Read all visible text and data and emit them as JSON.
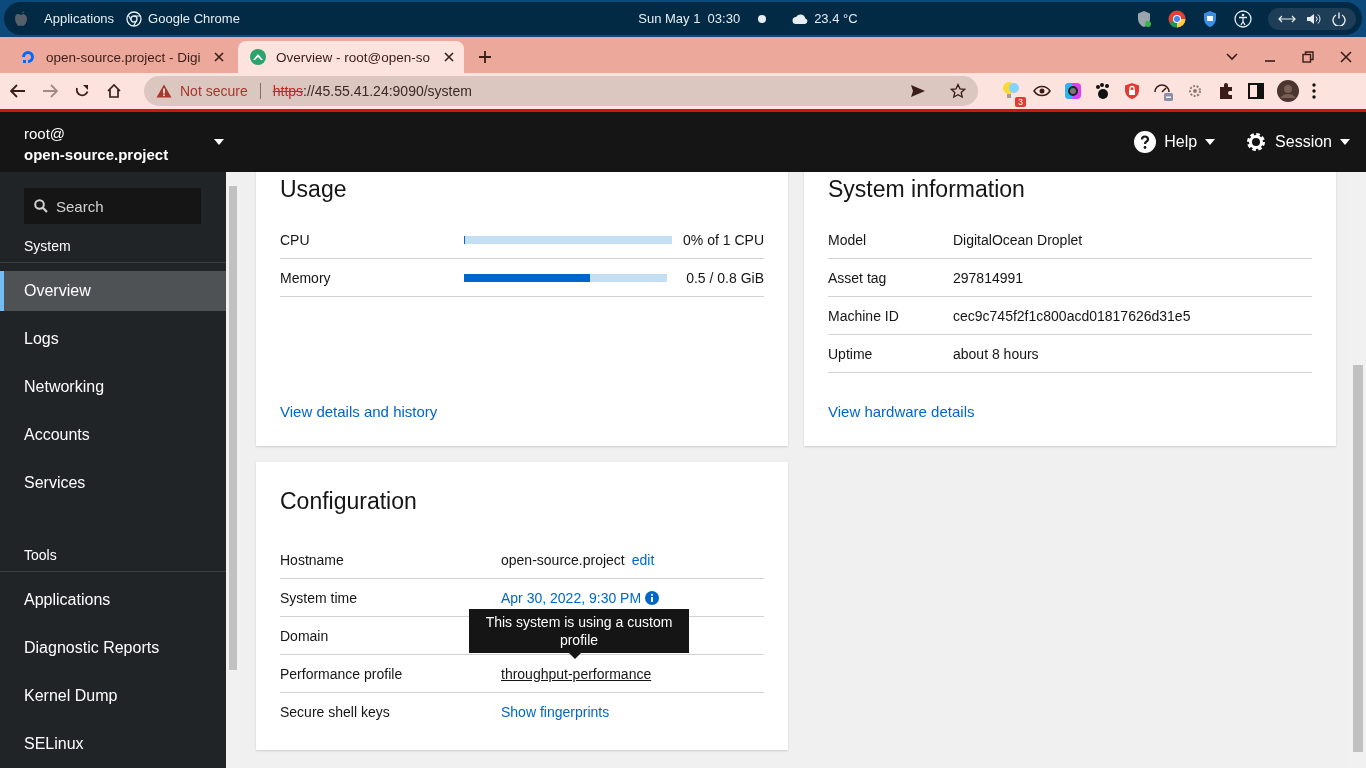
{
  "desktop_bar": {
    "items": [
      "Applications",
      "Google Chrome"
    ],
    "clock": "Sun May 1  03:30",
    "weather": "23.4 °C"
  },
  "browser": {
    "tabs": [
      {
        "title": "open-source.project - Digi",
        "selected": false
      },
      {
        "title": "Overview - root@open-so",
        "selected": true
      }
    ],
    "security": "Not secure",
    "url_scheme": "https",
    "url_rest": "://45.55.41.24:9090/system",
    "extension_badge": "3"
  },
  "sidebar": {
    "user": "root@",
    "host": "open-source.project",
    "search_placeholder": "Search",
    "sections": [
      {
        "title": "System",
        "items": [
          {
            "label": "Overview",
            "selected": true
          },
          {
            "label": "Logs",
            "selected": false
          },
          {
            "label": "Networking",
            "selected": false
          },
          {
            "label": "Accounts",
            "selected": false
          },
          {
            "label": "Services",
            "selected": false
          }
        ]
      },
      {
        "title": "Tools",
        "items": [
          {
            "label": "Applications",
            "selected": false
          },
          {
            "label": "Diagnostic Reports",
            "selected": false
          },
          {
            "label": "Kernel Dump",
            "selected": false
          },
          {
            "label": "SELinux",
            "selected": false
          }
        ]
      }
    ]
  },
  "header": {
    "help": "Help",
    "session": "Session"
  },
  "usage": {
    "title": "Usage",
    "meters": [
      {
        "name": "CPU",
        "level": 0,
        "reading": "0% of 1 CPU"
      },
      {
        "name": "Memory",
        "level": 0.62,
        "reading": "0.5 / 0.8 GiB"
      }
    ],
    "link": "View details and history"
  },
  "system_information": {
    "title": "System information",
    "rows": [
      {
        "label": "Model",
        "value": "DigitalOcean Droplet"
      },
      {
        "label": "Asset tag",
        "value": "297814991"
      },
      {
        "label": "Machine ID",
        "value": "cec9c745f2f1c800acd01817626d31e5"
      },
      {
        "label": "Uptime",
        "value": "about 8 hours"
      }
    ],
    "link": "View hardware details"
  },
  "configuration": {
    "title": "Configuration",
    "rows": [
      {
        "label": "Hostname",
        "kind": "text",
        "value": "open-source.project",
        "action": "edit"
      },
      {
        "label": "System time",
        "kind": "link",
        "value": "Apr 30, 2022, 9:30 PM",
        "info": true
      },
      {
        "label": "Domain",
        "kind": "empty"
      },
      {
        "label": "Performance profile",
        "kind": "underlined",
        "value": "throughput-performance",
        "tooltip": "This system is using a custom profile"
      },
      {
        "label": "Secure shell keys",
        "kind": "link",
        "value": "Show fingerprints"
      }
    ]
  }
}
